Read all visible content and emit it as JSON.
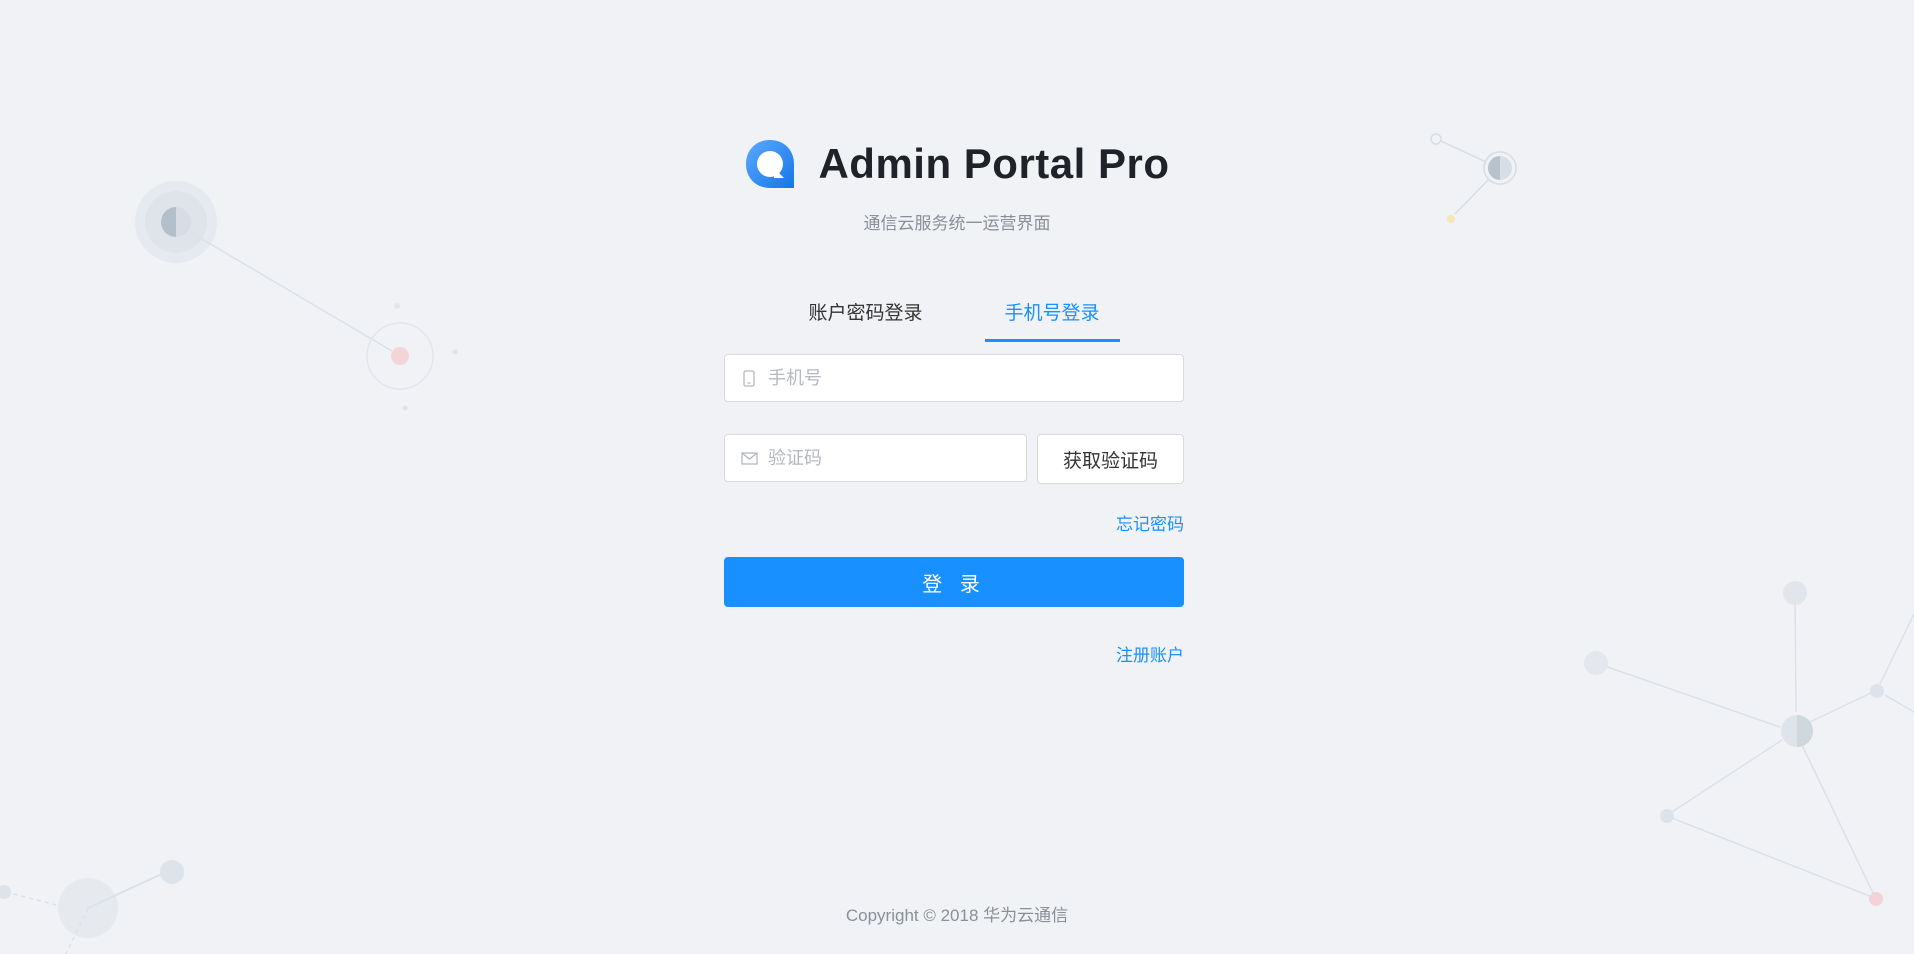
{
  "app": {
    "title": "Admin Portal Pro",
    "subtitle": "通信云服务统一运营界面"
  },
  "tabs": [
    {
      "label": "账户密码登录",
      "active": false
    },
    {
      "label": "手机号登录",
      "active": true
    }
  ],
  "form": {
    "phone_placeholder": "手机号",
    "phone_value": "",
    "code_placeholder": "验证码",
    "code_value": "",
    "get_code_label": "获取验证码",
    "forgot_label": "忘记密码",
    "submit_label": "登 录",
    "register_label": "注册账户"
  },
  "footer": {
    "copyright": "Copyright © 2018 华为云通信"
  },
  "icons": {
    "logo": "chat-bubble-logo-icon",
    "phone": "mobile-phone-icon",
    "code": "mail-icon"
  },
  "colors": {
    "accent": "#1890ff",
    "background": "#f0f2f5"
  }
}
